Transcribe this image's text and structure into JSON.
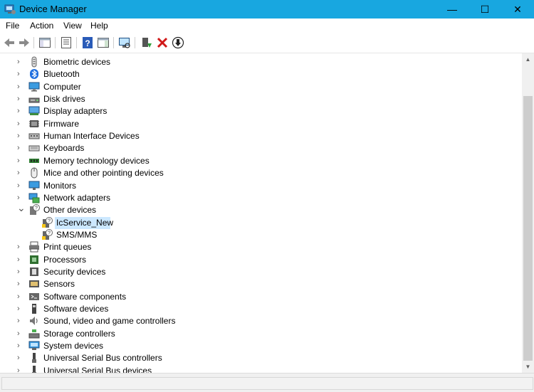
{
  "window": {
    "title": "Device Manager",
    "titlebar_color": "#18a7e0",
    "controls": {
      "minimize": "—",
      "maximize": "☐",
      "close": "✕"
    }
  },
  "menu": [
    "File",
    "Action",
    "View",
    "Help"
  ],
  "toolbar": {
    "buttons": [
      "back-arrow-icon",
      "forward-arrow-icon",
      "show-hide-console-tree-icon",
      "properties-icon",
      "help-icon",
      "action-pane-icon",
      "scan-hardware-changes-icon",
      "update-driver-icon",
      "uninstall-device-icon",
      "disable-device-icon"
    ]
  },
  "tree": {
    "items": [
      {
        "label": "Biometric devices",
        "icon": "biometric-icon",
        "expanded": false,
        "level": 0
      },
      {
        "label": "Bluetooth",
        "icon": "bluetooth-icon",
        "expanded": false,
        "level": 0
      },
      {
        "label": "Computer",
        "icon": "computer-icon",
        "expanded": false,
        "level": 0
      },
      {
        "label": "Disk drives",
        "icon": "disk-drive-icon",
        "expanded": false,
        "level": 0
      },
      {
        "label": "Display adapters",
        "icon": "display-adapter-icon",
        "expanded": false,
        "level": 0
      },
      {
        "label": "Firmware",
        "icon": "firmware-icon",
        "expanded": false,
        "level": 0
      },
      {
        "label": "Human Interface Devices",
        "icon": "hid-icon",
        "expanded": false,
        "level": 0
      },
      {
        "label": "Keyboards",
        "icon": "keyboard-icon",
        "expanded": false,
        "level": 0
      },
      {
        "label": "Memory technology devices",
        "icon": "memory-icon",
        "expanded": false,
        "level": 0
      },
      {
        "label": "Mice and other pointing devices",
        "icon": "mouse-icon",
        "expanded": false,
        "level": 0
      },
      {
        "label": "Monitors",
        "icon": "monitor-icon",
        "expanded": false,
        "level": 0
      },
      {
        "label": "Network adapters",
        "icon": "network-adapter-icon",
        "expanded": false,
        "level": 0
      },
      {
        "label": "Other devices",
        "icon": "unknown-device-icon",
        "expanded": true,
        "level": 0
      },
      {
        "label": "IcService_New",
        "icon": "unknown-device-warning-icon",
        "level": 1,
        "selected": true
      },
      {
        "label": "SMS/MMS",
        "icon": "unknown-device-warning-icon",
        "level": 1
      },
      {
        "label": "Print queues",
        "icon": "printer-icon",
        "expanded": false,
        "level": 0
      },
      {
        "label": "Processors",
        "icon": "processor-icon",
        "expanded": false,
        "level": 0
      },
      {
        "label": "Security devices",
        "icon": "security-device-icon",
        "expanded": false,
        "level": 0
      },
      {
        "label": "Sensors",
        "icon": "sensor-icon",
        "expanded": false,
        "level": 0
      },
      {
        "label": "Software components",
        "icon": "software-component-icon",
        "expanded": false,
        "level": 0
      },
      {
        "label": "Software devices",
        "icon": "software-device-icon",
        "expanded": false,
        "level": 0
      },
      {
        "label": "Sound, video and game controllers",
        "icon": "sound-icon",
        "expanded": false,
        "level": 0
      },
      {
        "label": "Storage controllers",
        "icon": "storage-controller-icon",
        "expanded": false,
        "level": 0
      },
      {
        "label": "System devices",
        "icon": "system-device-icon",
        "expanded": false,
        "level": 0
      },
      {
        "label": "Universal Serial Bus controllers",
        "icon": "usb-icon",
        "expanded": false,
        "level": 0
      },
      {
        "label": "Universal Serial Bus devices",
        "icon": "usb-icon",
        "expanded": false,
        "level": 0
      }
    ]
  },
  "colors": {
    "selection": "#cce8ff",
    "accent": "#18a7e0"
  }
}
